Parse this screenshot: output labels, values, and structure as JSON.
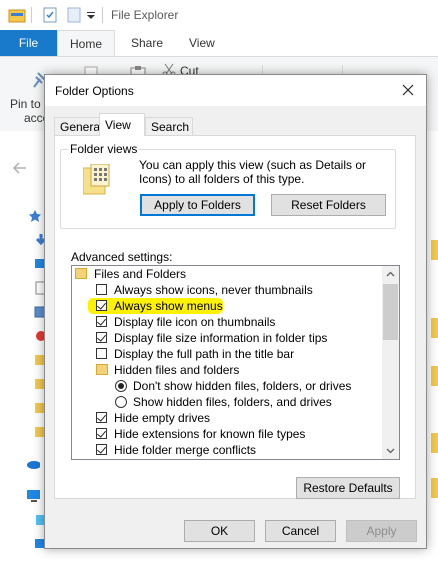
{
  "explorer": {
    "title": "File Explorer",
    "ribbon_tabs": [
      "File",
      "Home",
      "Share",
      "View"
    ],
    "ribbon_labels": {
      "pin": "Pin to",
      "pin2": "acce",
      "cut": "Cut"
    }
  },
  "dialog": {
    "title": "Folder Options",
    "tabs": [
      "General",
      "View",
      "Search"
    ],
    "active_tab": "View",
    "folder_views": {
      "legend": "Folder views",
      "description": "You can apply this view (such as Details or Icons) to all folders of this type.",
      "apply_button": "Apply to Folders",
      "reset_button": "Reset Folders"
    },
    "advanced_label": "Advanced settings:",
    "advanced_items": [
      {
        "type": "folder",
        "label": "Files and Folders"
      },
      {
        "type": "checkbox",
        "checked": false,
        "label": "Always show icons, never thumbnails"
      },
      {
        "type": "checkbox",
        "checked": true,
        "label": "Always show menus",
        "highlighted": true
      },
      {
        "type": "checkbox",
        "checked": true,
        "label": "Display file icon on thumbnails"
      },
      {
        "type": "checkbox",
        "checked": true,
        "label": "Display file size information in folder tips"
      },
      {
        "type": "checkbox",
        "checked": false,
        "label": "Display the full path in the title bar"
      },
      {
        "type": "folder",
        "label": "Hidden files and folders"
      },
      {
        "type": "radio",
        "checked": true,
        "label": "Don't show hidden files, folders, or drives"
      },
      {
        "type": "radio",
        "checked": false,
        "label": "Show hidden files, folders, and drives"
      },
      {
        "type": "checkbox",
        "checked": true,
        "label": "Hide empty drives"
      },
      {
        "type": "checkbox",
        "checked": true,
        "label": "Hide extensions for known file types"
      },
      {
        "type": "checkbox",
        "checked": true,
        "label": "Hide folder merge conflicts"
      }
    ],
    "restore_defaults": "Restore Defaults",
    "ok": "OK",
    "cancel": "Cancel",
    "apply": "Apply"
  },
  "colors": {
    "accent": "#0078d7",
    "file_tab": "#1979ca",
    "highlight": "#fff200"
  }
}
